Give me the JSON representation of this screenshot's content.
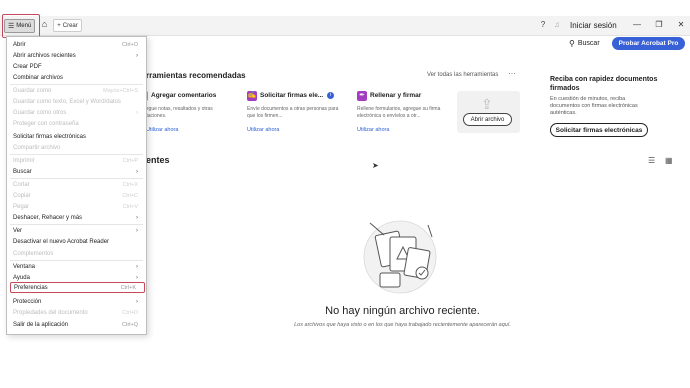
{
  "titlebar": {
    "menu_label": "Menú",
    "menu_icon": "hamburger-icon",
    "home_icon": "home-icon",
    "create_label": "Crear",
    "create_icon": "plus-icon",
    "help_icon": "help-icon",
    "bell_icon": "bell-icon",
    "signin_label": "Iniciar sesión",
    "minimize_icon": "minimize-icon",
    "maximize_icon": "maximize-icon",
    "close_icon": "close-icon"
  },
  "header": {
    "search_label": "Buscar",
    "try_pro_label": "Probar Acrobat Pro"
  },
  "recommended": {
    "title": "rramientas recomendadas",
    "see_all": "Ver todas las herramientas",
    "more": "···",
    "tools": [
      {
        "title": "Agregar comentarios",
        "desc": "Agregue notas, resaltados y otras anotaciones.",
        "link": "Utilizar ahora",
        "color": "#e8a21e",
        "icon": "comment-icon"
      },
      {
        "title": "Solicitar firmas ele...",
        "desc": "Envíe documentos a otras personas para que los firmen...",
        "link": "Utilizar ahora",
        "color": "#a43cc0",
        "icon": "sign-request-icon"
      },
      {
        "title": "Rellenar y firmar",
        "desc": "Rellene formularios, agregue su firma electrónica o envíelos a otr...",
        "link": "Utilizar ahora",
        "color": "#a43cc0",
        "icon": "fill-sign-icon"
      }
    ],
    "open_file_label": "Abrir archivo"
  },
  "promo": {
    "title": "Reciba con rapidez documentos firmados",
    "desc": "En cuestión de minutos, reciba documentos con firmas electrónicas auténticas.",
    "button": "Solicitar firmas electrónicas"
  },
  "recent": {
    "title": "entes",
    "empty_title": "No hay ningún archivo reciente.",
    "empty_sub": "Los archivos que haya visto o en los que haya trabajado recientemente aparecerán aquí."
  },
  "menu": {
    "items": [
      {
        "label": "Abrir",
        "shortcut": "Ctrl+O",
        "disabled": false,
        "submenu": false
      },
      {
        "label": "Abrir archivos recientes",
        "shortcut": "",
        "disabled": false,
        "submenu": true
      },
      {
        "label": "Crear PDF",
        "shortcut": "",
        "disabled": false,
        "submenu": false
      },
      {
        "label": "Combinar archivos",
        "shortcut": "",
        "disabled": false,
        "submenu": false
      },
      {
        "label": "Guardar como",
        "shortcut": "Mayús+Ctrl+S",
        "disabled": true,
        "submenu": false
      },
      {
        "label": "Guardar como texto, Excel y Word/datos",
        "shortcut": "",
        "disabled": true,
        "submenu": false
      },
      {
        "label": "Guardar como otros",
        "shortcut": "",
        "disabled": true,
        "submenu": true
      },
      {
        "label": "Proteger con contraseña",
        "shortcut": "",
        "disabled": true,
        "submenu": false
      },
      {
        "label": "Solicitar firmas electrónicas",
        "shortcut": "",
        "disabled": false,
        "submenu": false
      },
      {
        "label": "Compartir archivo",
        "shortcut": "",
        "disabled": true,
        "submenu": false
      },
      {
        "label": "Imprimir",
        "shortcut": "Ctrl+P",
        "disabled": true,
        "submenu": false
      },
      {
        "label": "Buscar",
        "shortcut": "",
        "disabled": false,
        "submenu": true
      },
      {
        "label": "Cortar",
        "shortcut": "Ctrl+X",
        "disabled": true,
        "submenu": false
      },
      {
        "label": "Copiar",
        "shortcut": "Ctrl+C",
        "disabled": true,
        "submenu": false
      },
      {
        "label": "Pegar",
        "shortcut": "Ctrl+V",
        "disabled": true,
        "submenu": false
      },
      {
        "label": "Deshacer, Rehacer y más",
        "shortcut": "",
        "disabled": false,
        "submenu": true
      },
      {
        "label": "Ver",
        "shortcut": "",
        "disabled": false,
        "submenu": true
      },
      {
        "label": "Desactivar el nuevo Acrobat Reader",
        "shortcut": "",
        "disabled": false,
        "submenu": false
      },
      {
        "label": "Complementos",
        "shortcut": "",
        "disabled": true,
        "submenu": false
      },
      {
        "label": "Ventana",
        "shortcut": "",
        "disabled": false,
        "submenu": true
      },
      {
        "label": "Ayuda",
        "shortcut": "",
        "disabled": false,
        "submenu": true
      },
      {
        "label": "Preferencias",
        "shortcut": "Ctrl+K",
        "disabled": false,
        "submenu": false,
        "highlight": true
      },
      {
        "label": "Protección",
        "shortcut": "",
        "disabled": false,
        "submenu": true
      },
      {
        "label": "Propiedades del documento",
        "shortcut": "Ctrl+D",
        "disabled": true,
        "submenu": false
      },
      {
        "label": "Salir de la aplicación",
        "shortcut": "Ctrl+Q",
        "disabled": false,
        "submenu": false
      }
    ]
  }
}
